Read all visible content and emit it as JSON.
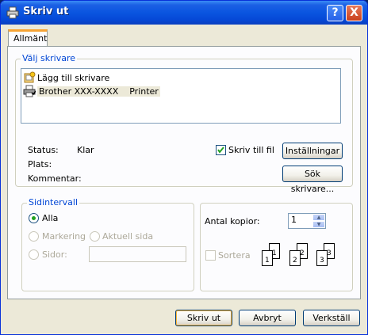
{
  "window": {
    "title": "Skriv ut",
    "help_label": "?",
    "close_label": "X"
  },
  "tabs": [
    {
      "label": "Allmänt"
    }
  ],
  "printer_group": {
    "legend": "Välj skrivare",
    "items": [
      {
        "label": "Lägg till skrivare",
        "icon": "add-printer-icon"
      },
      {
        "label": "Brother XXX-XXXX    Printer",
        "icon": "printer-icon"
      }
    ],
    "status_label": "Status:",
    "status_value": "Klar",
    "location_label": "Plats:",
    "location_value": "",
    "comment_label": "Kommentar:",
    "comment_value": "",
    "print_to_file_label": "Skriv till fil",
    "print_to_file_checked": true,
    "preferences_label": "Inställningar",
    "find_printer_label": "Sök skrivare..."
  },
  "page_range": {
    "legend": "Sidintervall",
    "all_label": "Alla",
    "selection_label": "Markering",
    "current_page_label": "Aktuell sida",
    "pages_label": "Sidor:",
    "pages_value": "",
    "selected": "Alla"
  },
  "copies": {
    "count_label": "Antal kopior:",
    "count_value": "1",
    "collate_label": "Sortera",
    "collate_checked": false,
    "page_numbers": [
      "1",
      "1",
      "2",
      "2",
      "3",
      "3"
    ]
  },
  "footer": {
    "print_label": "Skriv ut",
    "cancel_label": "Avbryt",
    "apply_label": "Verkställ"
  }
}
